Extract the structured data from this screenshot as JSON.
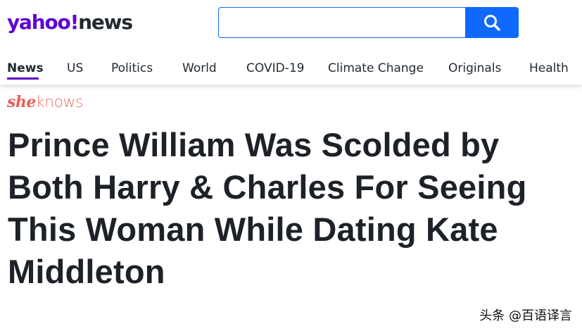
{
  "header": {
    "logo": {
      "yahoo": "yahoo",
      "bang": "!",
      "news": "news"
    },
    "search": {
      "value": "",
      "placeholder": ""
    }
  },
  "nav": {
    "items": [
      {
        "label": "News",
        "active": true
      },
      {
        "label": "US"
      },
      {
        "label": "Politics"
      },
      {
        "label": "World"
      },
      {
        "label": "COVID-19"
      },
      {
        "label": "Climate Change"
      },
      {
        "label": "Originals"
      },
      {
        "label": "Health"
      }
    ]
  },
  "article": {
    "source": {
      "she": "she",
      "knows": "knows"
    },
    "headline": "Prince William Was Scolded by Both Harry & Charles For Seeing This Woman While Dating Kate Middleton"
  },
  "watermark": "头条 @百语译言",
  "colors": {
    "brand_purple": "#6001d2",
    "search_blue": "#0f69ff",
    "sheknows_coral": "#e75f5a",
    "text_dark": "#1d2228"
  }
}
